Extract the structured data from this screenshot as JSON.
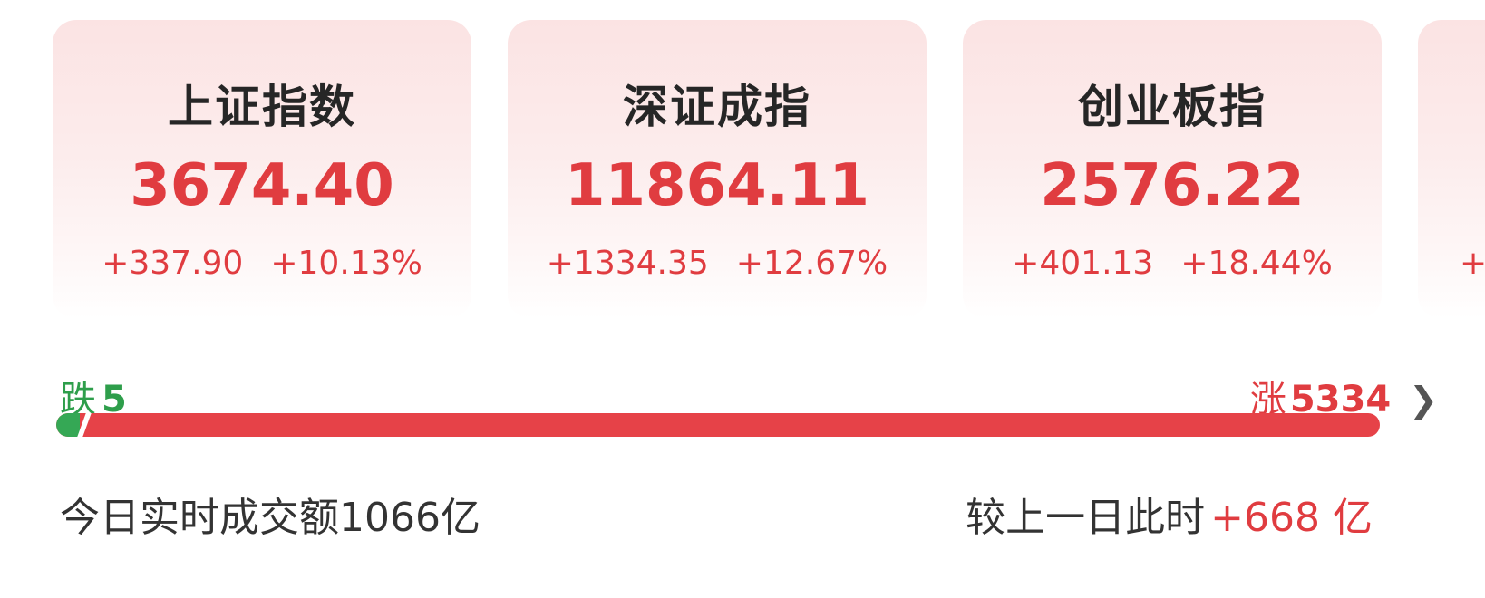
{
  "indices": [
    {
      "name": "上证指数",
      "value": "3674.40",
      "change": "+337.90",
      "change_pct": "+10.13%"
    },
    {
      "name": "深证成指",
      "value": "11864.11",
      "change": "+1334.35",
      "change_pct": "+12.67%"
    },
    {
      "name": "创业板指",
      "value": "2576.22",
      "change": "+401.13",
      "change_pct": "+18.44%"
    },
    {
      "name": "",
      "value": "",
      "change": "+",
      "change_pct": ""
    }
  ],
  "breadth": {
    "down_label": "跌",
    "down_count": "5",
    "up_label": "涨",
    "up_count": "5334",
    "down_fraction": 0.0009
  },
  "turnover": {
    "label": "今日实时成交额",
    "amount": "1066亿",
    "compare_label": "较上一日此时",
    "compare_delta": "+668 亿"
  },
  "colors": {
    "up": "#e03c40",
    "down": "#2e9e4b"
  },
  "icons": {
    "more": "chevron-right-icon"
  }
}
